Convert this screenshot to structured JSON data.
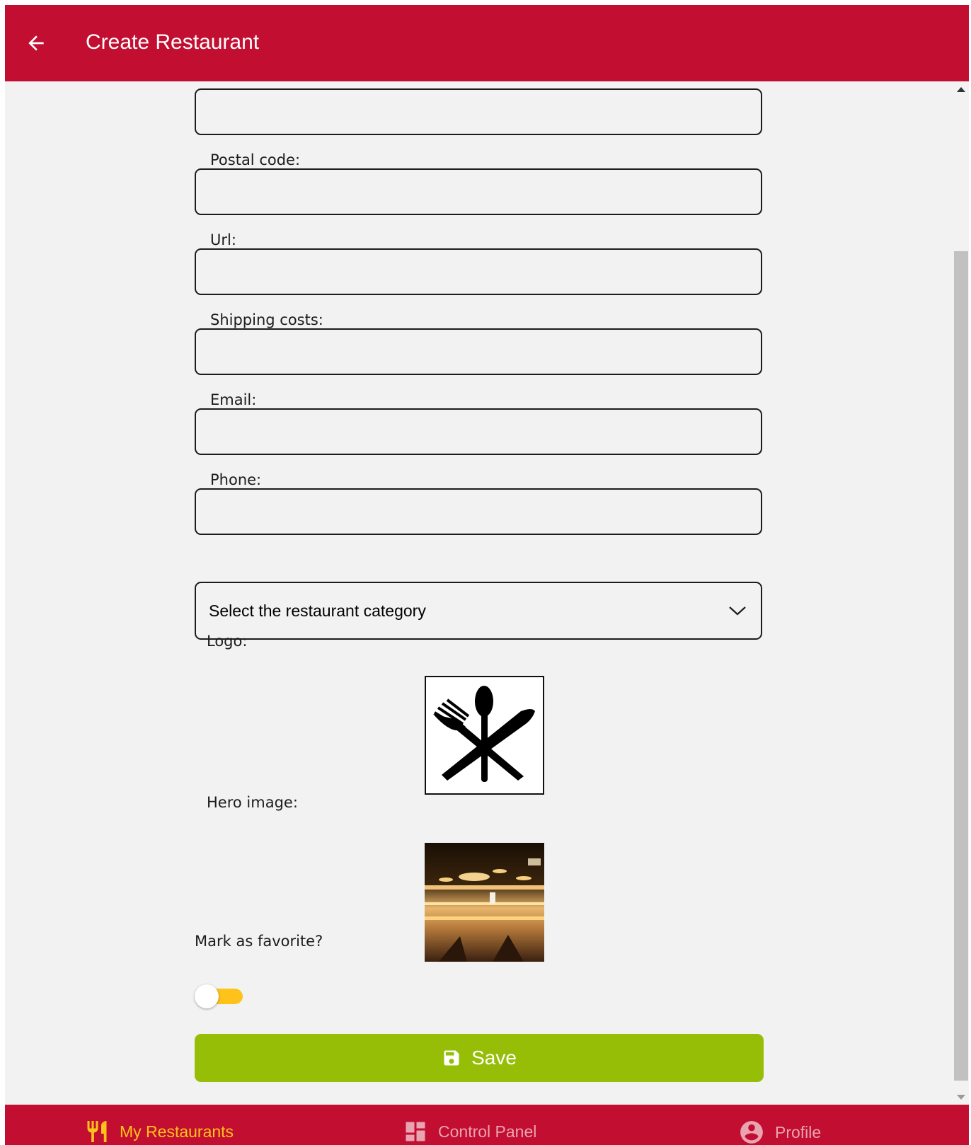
{
  "header": {
    "title": "Create Restaurant"
  },
  "form": {
    "fields": [
      {
        "label": "",
        "value": ""
      },
      {
        "label": "Postal code:",
        "value": ""
      },
      {
        "label": "Url:",
        "value": ""
      },
      {
        "label": "Shipping costs:",
        "value": ""
      },
      {
        "label": "Email:",
        "value": ""
      },
      {
        "label": "Phone:",
        "value": ""
      }
    ],
    "category_select": {
      "selected": "Select the restaurant category"
    },
    "logo_label": "Logo:",
    "hero_label": "Hero image:",
    "favorite_label": "Mark as favorite?",
    "favorite_on": false,
    "save_label": "Save"
  },
  "bottom_nav": {
    "items": [
      {
        "label": "My Restaurants",
        "icon": "restaurant-icon",
        "active": true
      },
      {
        "label": "Control Panel",
        "icon": "dashboard-icon",
        "active": false
      },
      {
        "label": "Profile",
        "icon": "account-circle-icon",
        "active": false
      }
    ]
  },
  "colors": {
    "brand_red": "#c20e30",
    "accent_yellow": "#fdc31a",
    "save_green": "#96be06",
    "background": "#f2f2f2"
  }
}
